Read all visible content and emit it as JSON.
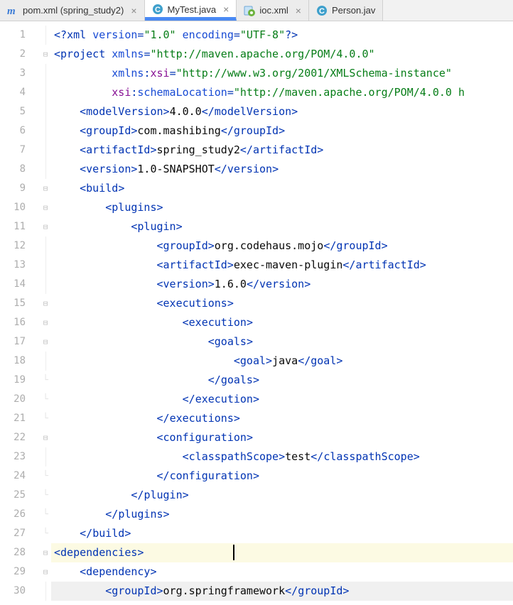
{
  "tabs": [
    {
      "label": "pom.xml (spring_study2)",
      "active": false,
      "icon": "maven"
    },
    {
      "label": "MyTest.java",
      "active": true,
      "icon": "class"
    },
    {
      "label": "ioc.xml",
      "active": false,
      "icon": "springxml"
    },
    {
      "label": "Person.jav",
      "active": false,
      "icon": "class",
      "noclose": true
    }
  ],
  "lines": [
    {
      "n": 1,
      "ind": 0,
      "segs": [
        [
          "br",
          "<?"
        ],
        [
          "tag",
          "xml "
        ],
        [
          "attr",
          "version"
        ],
        [
          "br",
          "="
        ],
        [
          "str",
          "\"1.0\""
        ],
        [
          "txt",
          " "
        ],
        [
          "attr",
          "encoding"
        ],
        [
          "br",
          "="
        ],
        [
          "str",
          "\"UTF-8\""
        ],
        [
          "br",
          "?>"
        ]
      ]
    },
    {
      "n": 2,
      "ind": 0,
      "fold": "open",
      "segs": [
        [
          "br",
          "<"
        ],
        [
          "tag",
          "project "
        ],
        [
          "attr",
          "xmlns"
        ],
        [
          "br",
          "="
        ],
        [
          "str",
          "\"http://maven.apache.org/POM/4.0.0\""
        ]
      ]
    },
    {
      "n": 3,
      "ind": 9,
      "segs": [
        [
          "attr",
          "xmlns"
        ],
        [
          "br",
          ":"
        ],
        [
          "ns",
          "xsi"
        ],
        [
          "br",
          "="
        ],
        [
          "str",
          "\"http://www.w3.org/2001/XMLSchema-instance\""
        ]
      ]
    },
    {
      "n": 4,
      "ind": 9,
      "segs": [
        [
          "ns",
          "xsi"
        ],
        [
          "br",
          ":"
        ],
        [
          "attr",
          "schemaLocation"
        ],
        [
          "br",
          "="
        ],
        [
          "str",
          "\"http://maven.apache.org/POM/4.0.0 h"
        ]
      ]
    },
    {
      "n": 5,
      "ind": 4,
      "segs": [
        [
          "br",
          "<"
        ],
        [
          "tag",
          "modelVersion"
        ],
        [
          "br",
          ">"
        ],
        [
          "txt",
          "4.0.0"
        ],
        [
          "br",
          "</"
        ],
        [
          "tag",
          "modelVersion"
        ],
        [
          "br",
          ">"
        ]
      ]
    },
    {
      "n": 6,
      "ind": 4,
      "segs": [
        [
          "br",
          "<"
        ],
        [
          "tag",
          "groupId"
        ],
        [
          "br",
          ">"
        ],
        [
          "txt",
          "com.mashibing"
        ],
        [
          "br",
          "</"
        ],
        [
          "tag",
          "groupId"
        ],
        [
          "br",
          ">"
        ]
      ]
    },
    {
      "n": 7,
      "ind": 4,
      "segs": [
        [
          "br",
          "<"
        ],
        [
          "tag",
          "artifactId"
        ],
        [
          "br",
          ">"
        ],
        [
          "txt",
          "spring_study2"
        ],
        [
          "br",
          "</"
        ],
        [
          "tag",
          "artifactId"
        ],
        [
          "br",
          ">"
        ]
      ]
    },
    {
      "n": 8,
      "ind": 4,
      "segs": [
        [
          "br",
          "<"
        ],
        [
          "tag",
          "version"
        ],
        [
          "br",
          ">"
        ],
        [
          "txt",
          "1.0-SNAPSHOT"
        ],
        [
          "br",
          "</"
        ],
        [
          "tag",
          "version"
        ],
        [
          "br",
          ">"
        ]
      ]
    },
    {
      "n": 9,
      "ind": 4,
      "fold": "open",
      "segs": [
        [
          "br",
          "<"
        ],
        [
          "tag",
          "build"
        ],
        [
          "br",
          ">"
        ]
      ]
    },
    {
      "n": 10,
      "ind": 8,
      "fold": "open",
      "segs": [
        [
          "br",
          "<"
        ],
        [
          "tag",
          "plugins"
        ],
        [
          "br",
          ">"
        ]
      ]
    },
    {
      "n": 11,
      "ind": 12,
      "fold": "open",
      "segs": [
        [
          "br",
          "<"
        ],
        [
          "tag",
          "plugin"
        ],
        [
          "br",
          ">"
        ]
      ]
    },
    {
      "n": 12,
      "ind": 16,
      "segs": [
        [
          "br",
          "<"
        ],
        [
          "tag",
          "groupId"
        ],
        [
          "br",
          ">"
        ],
        [
          "txt",
          "org.codehaus.mojo"
        ],
        [
          "br",
          "</"
        ],
        [
          "tag",
          "groupId"
        ],
        [
          "br",
          ">"
        ]
      ]
    },
    {
      "n": 13,
      "ind": 16,
      "segs": [
        [
          "br",
          "<"
        ],
        [
          "tag",
          "artifactId"
        ],
        [
          "br",
          ">"
        ],
        [
          "txt",
          "exec-maven-plugin"
        ],
        [
          "br",
          "</"
        ],
        [
          "tag",
          "artifactId"
        ],
        [
          "br",
          ">"
        ]
      ]
    },
    {
      "n": 14,
      "ind": 16,
      "segs": [
        [
          "br",
          "<"
        ],
        [
          "tag",
          "version"
        ],
        [
          "br",
          ">"
        ],
        [
          "txt",
          "1.6.0"
        ],
        [
          "br",
          "</"
        ],
        [
          "tag",
          "version"
        ],
        [
          "br",
          ">"
        ]
      ]
    },
    {
      "n": 15,
      "ind": 16,
      "fold": "open",
      "segs": [
        [
          "br",
          "<"
        ],
        [
          "tag",
          "executions"
        ],
        [
          "br",
          ">"
        ]
      ]
    },
    {
      "n": 16,
      "ind": 20,
      "fold": "open",
      "segs": [
        [
          "br",
          "<"
        ],
        [
          "tag",
          "execution"
        ],
        [
          "br",
          ">"
        ]
      ]
    },
    {
      "n": 17,
      "ind": 24,
      "fold": "open",
      "segs": [
        [
          "br",
          "<"
        ],
        [
          "tag",
          "goals"
        ],
        [
          "br",
          ">"
        ]
      ]
    },
    {
      "n": 18,
      "ind": 28,
      "segs": [
        [
          "br",
          "<"
        ],
        [
          "tag",
          "goal"
        ],
        [
          "br",
          ">"
        ],
        [
          "txt",
          "java"
        ],
        [
          "br",
          "</"
        ],
        [
          "tag",
          "goal"
        ],
        [
          "br",
          ">"
        ]
      ]
    },
    {
      "n": 19,
      "ind": 24,
      "fold": "close",
      "segs": [
        [
          "br",
          "</"
        ],
        [
          "tag",
          "goals"
        ],
        [
          "br",
          ">"
        ]
      ]
    },
    {
      "n": 20,
      "ind": 20,
      "fold": "close",
      "segs": [
        [
          "br",
          "</"
        ],
        [
          "tag",
          "execution"
        ],
        [
          "br",
          ">"
        ]
      ]
    },
    {
      "n": 21,
      "ind": 16,
      "fold": "close",
      "segs": [
        [
          "br",
          "</"
        ],
        [
          "tag",
          "executions"
        ],
        [
          "br",
          ">"
        ]
      ]
    },
    {
      "n": 22,
      "ind": 16,
      "fold": "open",
      "segs": [
        [
          "br",
          "<"
        ],
        [
          "tag",
          "configuration"
        ],
        [
          "br",
          ">"
        ]
      ]
    },
    {
      "n": 23,
      "ind": 20,
      "segs": [
        [
          "br",
          "<"
        ],
        [
          "tag",
          "classpathScope"
        ],
        [
          "br",
          ">"
        ],
        [
          "txt",
          "test"
        ],
        [
          "br",
          "</"
        ],
        [
          "tag",
          "classpathScope"
        ],
        [
          "br",
          ">"
        ]
      ]
    },
    {
      "n": 24,
      "ind": 16,
      "fold": "close",
      "segs": [
        [
          "br",
          "</"
        ],
        [
          "tag",
          "configuration"
        ],
        [
          "br",
          ">"
        ]
      ]
    },
    {
      "n": 25,
      "ind": 12,
      "fold": "close",
      "segs": [
        [
          "br",
          "</"
        ],
        [
          "tag",
          "plugin"
        ],
        [
          "br",
          ">"
        ]
      ]
    },
    {
      "n": 26,
      "ind": 8,
      "fold": "close",
      "segs": [
        [
          "br",
          "</"
        ],
        [
          "tag",
          "plugins"
        ],
        [
          "br",
          ">"
        ]
      ]
    },
    {
      "n": 27,
      "ind": 4,
      "fold": "close",
      "segs": [
        [
          "br",
          "</"
        ],
        [
          "tag",
          "build"
        ],
        [
          "br",
          ">"
        ]
      ]
    },
    {
      "n": 28,
      "ind": 0,
      "fold": "open",
      "highlight": true,
      "caret": true,
      "segs": [
        [
          "br",
          "<"
        ],
        [
          "tag",
          "dependencies"
        ],
        [
          "br",
          ">"
        ]
      ]
    },
    {
      "n": 29,
      "ind": 4,
      "fold": "open",
      "segs": [
        [
          "br",
          "<"
        ],
        [
          "tag",
          "dependency"
        ],
        [
          "br",
          ">"
        ]
      ]
    },
    {
      "n": 30,
      "ind": 8,
      "grey": true,
      "segs": [
        [
          "br",
          "<"
        ],
        [
          "tag",
          "groupId"
        ],
        [
          "br",
          ">"
        ],
        [
          "txt",
          "org.springframework"
        ],
        [
          "br",
          "</"
        ],
        [
          "tag",
          "groupId"
        ],
        [
          "br",
          ">"
        ]
      ]
    }
  ]
}
